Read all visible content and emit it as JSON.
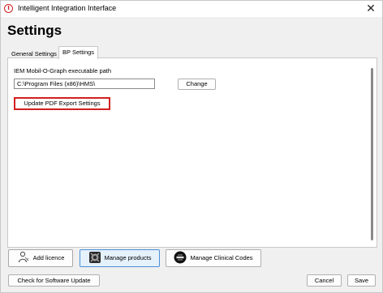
{
  "window": {
    "title": "Intelligent Integration Interface",
    "close_glyph": "✕",
    "app_icon_letter": "I"
  },
  "page": {
    "title": "Settings"
  },
  "tabs": [
    {
      "label": "General Settings",
      "active": false
    },
    {
      "label": "BP Settings",
      "active": true
    }
  ],
  "bp_settings": {
    "path_label": "IEM Mobil-O-Graph executable path",
    "path_value": "C:\\Program Files (x86)\\HMS\\",
    "change_label": "Change",
    "update_pdf_label": "Update PDF Export Settings",
    "highlight_color": "#d21f1f"
  },
  "actions": {
    "add_licence": {
      "label": "Add licence",
      "icon": "person-key-icon"
    },
    "manage_products": {
      "label": "Manage products",
      "icon": "products-icon"
    },
    "manage_codes": {
      "label": "Manage Clinical Codes",
      "icon": "clinical-codes-icon"
    }
  },
  "footer": {
    "check_update_label": "Check for Software Update",
    "cancel_label": "Cancel",
    "save_label": "Save"
  }
}
